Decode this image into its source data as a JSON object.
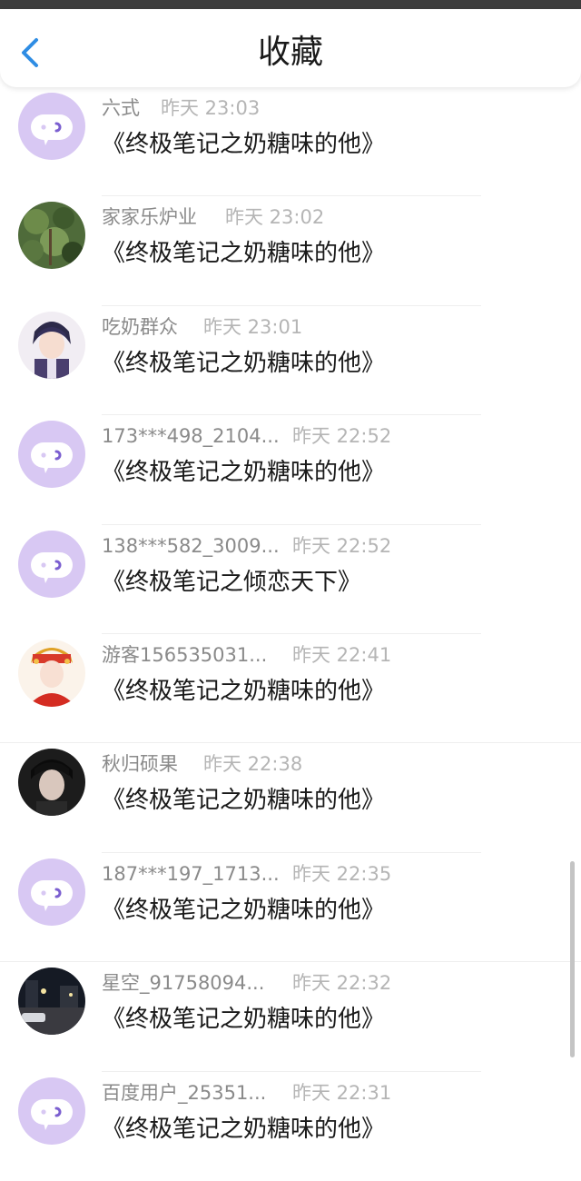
{
  "header": {
    "title": "收藏",
    "back_icon": "chevron-left-icon",
    "accent_color": "#2f8de4"
  },
  "items": [
    {
      "username": "六式",
      "time": "昨天 23:03",
      "title": "《终极笔记之奶糖味的他》",
      "avatar": "default-chat-avatar"
    },
    {
      "username": "家家乐炉业",
      "time": "昨天 23:02",
      "title": "《终极笔记之奶糖味的他》",
      "avatar": "user-photo-plants"
    },
    {
      "username": "吃奶群众",
      "time": "昨天 23:01",
      "title": "《终极笔记之奶糖味的他》",
      "avatar": "user-photo-anime"
    },
    {
      "username": "173***498_2104...",
      "time": "昨天 22:52",
      "title": "《终极笔记之奶糖味的他》",
      "avatar": "default-chat-avatar"
    },
    {
      "username": "138***582_3009...",
      "time": "昨天 22:52",
      "title": "《终极笔记之倾恋天下》",
      "avatar": "default-chat-avatar"
    },
    {
      "username": "游客156535031...",
      "time": "昨天 22:41",
      "title": "《终极笔记之奶糖味的他》",
      "avatar": "user-photo-costume"
    },
    {
      "username": "秋归硕果",
      "time": "昨天 22:38",
      "title": "《终极笔记之奶糖味的他》",
      "avatar": "user-photo-portrait"
    },
    {
      "username": "187***197_1713...",
      "time": "昨天 22:35",
      "title": "《终极笔记之奶糖味的他》",
      "avatar": "default-chat-avatar"
    },
    {
      "username": "星空_91758094...",
      "time": "昨天 22:32",
      "title": "《终极笔记之奶糖味的他》",
      "avatar": "user-photo-street"
    },
    {
      "username": "百度用户_25351...",
      "time": "昨天 22:31",
      "title": "《终极笔记之奶糖味的他》",
      "avatar": "default-chat-avatar"
    }
  ]
}
